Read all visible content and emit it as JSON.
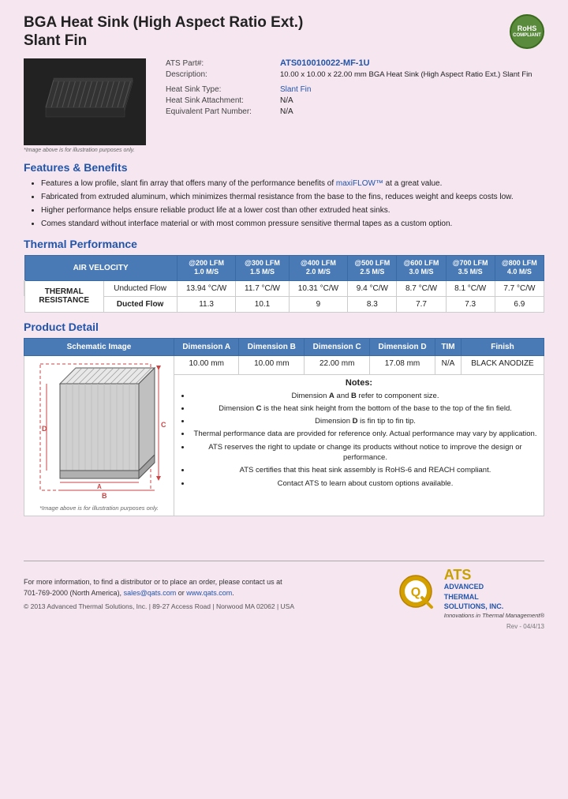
{
  "header": {
    "title_line1": "BGA Heat Sink (High Aspect Ratio Ext.)",
    "title_line2": "Slant Fin",
    "rohs": "RoHS\nCOMPLIANT"
  },
  "product": {
    "part_label": "ATS Part#:",
    "part_value": "ATS010010022-MF-1U",
    "description_label": "Description:",
    "description_value": "10.00 x 10.00 x 22.00 mm BGA Heat Sink (High Aspect Ratio Ext.) Slant Fin",
    "heatsink_type_label": "Heat Sink Type:",
    "heatsink_type_value": "Slant Fin",
    "attachment_label": "Heat Sink Attachment:",
    "attachment_value": "N/A",
    "equiv_part_label": "Equivalent Part Number:",
    "equiv_part_value": "N/A",
    "image_caption": "*Image above is for illustration purposes only."
  },
  "features": {
    "heading": "Features & Benefits",
    "items": [
      "Features a low profile, slant fin array that offers many of the performance benefits of maxiFLOW™ at a great value.",
      "Fabricated from extruded aluminum, which minimizes thermal resistance from the base to the fins, reduces weight and keeps costs low.",
      "Higher performance helps ensure reliable product life at a lower cost than other extruded heat sinks.",
      "Comes standard without interface material or with most common pressure sensitive thermal tapes as a custom option."
    ]
  },
  "thermal_performance": {
    "heading": "Thermal Performance",
    "col_headers": [
      {
        "line1": "",
        "line2": "AIR VELOCITY",
        "span": 1,
        "is_air_velocity": true
      },
      {
        "line1": "@200 LFM",
        "line2": "1.0 M/S"
      },
      {
        "line1": "@300 LFM",
        "line2": "1.5 M/S"
      },
      {
        "line1": "@400 LFM",
        "line2": "2.0 M/S"
      },
      {
        "line1": "@500 LFM",
        "line2": "2.5 M/S"
      },
      {
        "line1": "@600 LFM",
        "line2": "3.0 M/S"
      },
      {
        "line1": "@700 LFM",
        "line2": "3.5 M/S"
      },
      {
        "line1": "@800 LFM",
        "line2": "4.0 M/S"
      }
    ],
    "row_group_label": "THERMAL RESISTANCE",
    "rows": [
      {
        "label": "Unducted Flow",
        "values": [
          "13.94 °C/W",
          "11.7 °C/W",
          "10.31 °C/W",
          "9.4 °C/W",
          "8.7 °C/W",
          "8.1 °C/W",
          "7.7 °C/W"
        ]
      },
      {
        "label": "Ducted Flow",
        "values": [
          "11.3",
          "10.1",
          "9",
          "8.3",
          "7.7",
          "7.3",
          "6.9"
        ]
      }
    ]
  },
  "product_detail": {
    "heading": "Product Detail",
    "col_headers": [
      "Schematic Image",
      "Dimension A",
      "Dimension B",
      "Dimension C",
      "Dimension D",
      "TIM",
      "Finish"
    ],
    "dim_values": [
      "10.00 mm",
      "10.00 mm",
      "22.00 mm",
      "17.08 mm",
      "N/A",
      "BLACK ANODIZE"
    ],
    "notes_title": "Notes:",
    "notes": [
      "Dimension A and B refer to component size.",
      "Dimension C is the heat sink height from the bottom of the base to the top of the fin field.",
      "Dimension D is fin tip to fin tip.",
      "Thermal performance data are provided for reference only. Actual performance may vary by application.",
      "ATS reserves the right to update or change its products without notice to improve the design or performance.",
      "ATS certifies that this heat sink assembly is RoHS-6 and REACH compliant.",
      "Contact ATS to learn about custom options available."
    ],
    "schematic_caption": "*Image above is for illustration purposes only."
  },
  "footer": {
    "contact_text": "For more information, to find a distributor or to place an order, please contact us at\n701-769-2000 (North America),",
    "email": "sales@qats.com",
    "or_text": "or",
    "website": "www.qats.com",
    "copyright": "© 2013 Advanced Thermal Solutions, Inc. | 89-27 Access Road | Norwood MA  02062 | USA",
    "rev": "Rev - 04/4/13",
    "ats_q_symbol": "Q",
    "ats_big": "ATS",
    "ats_name": "ADVANCED\nTHERMAL\nSOLUTIONS, INC.",
    "ats_tagline": "Innovations in Thermal Management®"
  }
}
